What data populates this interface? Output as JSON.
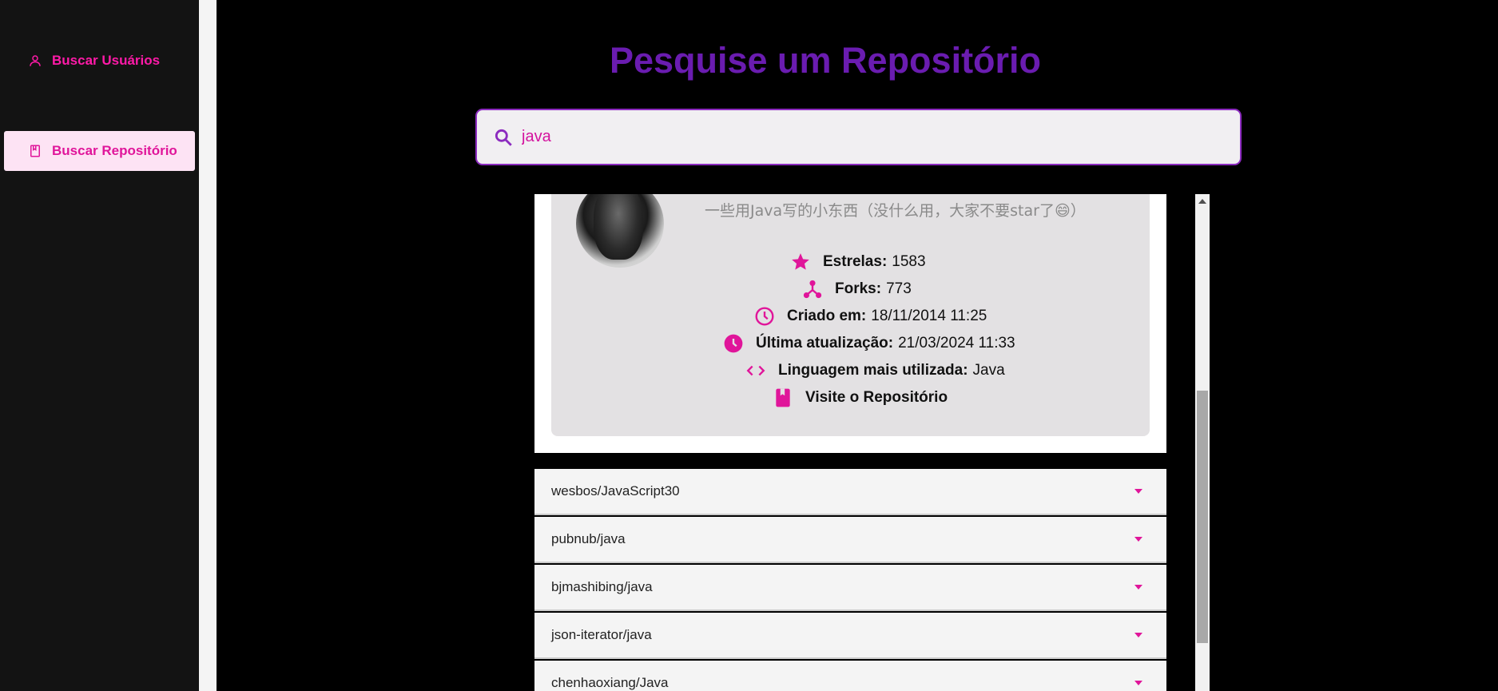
{
  "sidebar": {
    "items": [
      {
        "label": "Buscar Usuários",
        "icon": "user-icon"
      },
      {
        "label": "Buscar Repositório",
        "icon": "book-icon",
        "active": true
      }
    ]
  },
  "main": {
    "title": "Pesquise um Repositório",
    "search": {
      "value": "java",
      "icon": "search-icon"
    }
  },
  "repo_card": {
    "description": "一些用Java写的小东西（没什么用，大家不要star了😄）",
    "stats": {
      "stars_label": "Estrelas:",
      "stars_value": "1583",
      "forks_label": "Forks:",
      "forks_value": "773",
      "created_label": "Criado em:",
      "created_value": "18/11/2014 11:25",
      "updated_label": "Última atualização:",
      "updated_value": "21/03/2024 11:33",
      "lang_label": "Linguagem mais utilizada:",
      "lang_value": "Java",
      "visit_label": "Visite o Repositório"
    }
  },
  "repo_list": [
    {
      "name": "wesbos/JavaScript30"
    },
    {
      "name": "pubnub/java"
    },
    {
      "name": "bjmashibing/java"
    },
    {
      "name": "json-iterator/java"
    },
    {
      "name": "chenhaoxiang/Java"
    }
  ],
  "colors": {
    "accent": "#ff1aa8",
    "title": "#6a1cb0",
    "active_bg": "#fde3f4"
  }
}
